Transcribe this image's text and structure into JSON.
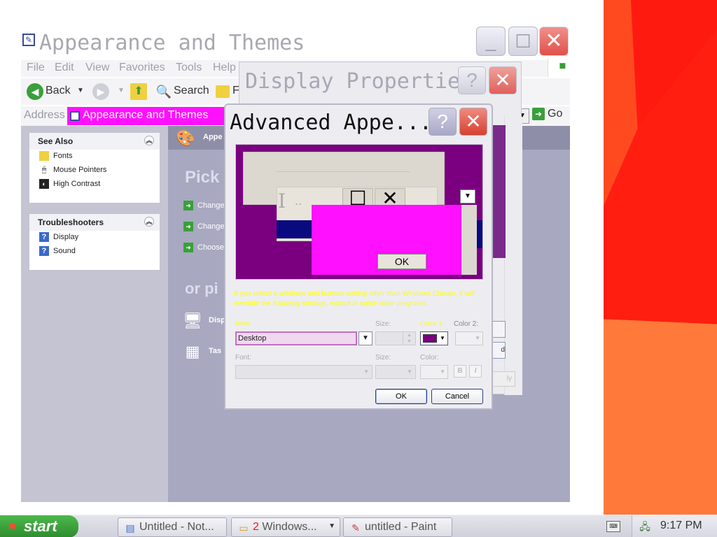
{
  "explorer": {
    "title": "Appearance and Themes",
    "menu": [
      "File",
      "Edit",
      "View",
      "Favorites",
      "Tools",
      "Help"
    ],
    "toolbar": {
      "back": "Back",
      "search": "Search",
      "folders": "F"
    },
    "address": {
      "label": "Address",
      "value": "Appearance and Themes",
      "go": "Go"
    },
    "see_also": {
      "title": "See Also",
      "items": [
        "Fonts",
        "Mouse Pointers",
        "High Contrast"
      ]
    },
    "troubleshooters": {
      "title": "Troubleshooters",
      "items": [
        "Display",
        "Sound"
      ]
    },
    "main": {
      "header": "Appe",
      "pick": "Pick",
      "links": [
        "Change",
        "Change",
        "Choose"
      ],
      "or_pick": "or pi",
      "icons": [
        "Disp",
        "Tas"
      ]
    }
  },
  "display_props": {
    "title": "Display Properties",
    "side_label": "d",
    "apply": "ly"
  },
  "advanced": {
    "title": "Advanced Appe...",
    "preview": {
      "ibeam": "I",
      "dots": "..",
      "ok": "OK"
    },
    "note": "If you select a windows and buttons setting other than Windows Classic, it will override the following settings, except in some older programs.",
    "item_label": "Item:",
    "item_value": "Desktop",
    "size_label": "Size:",
    "color1_label": "Color 1:",
    "color2_label": "Color 2:",
    "font_label": "Font:",
    "fsize_label": "Size:",
    "fcolor_label": "Color:",
    "bold": "B",
    "italic": "I",
    "ok": "OK",
    "cancel": "Cancel"
  },
  "taskbar": {
    "start": "start",
    "buttons": [
      {
        "label": "Untitled - Not..."
      },
      {
        "count": "2",
        "label": "Windows..."
      },
      {
        "label": "untitled - Paint"
      }
    ],
    "clock": "9:17 PM"
  },
  "colors": {
    "desktop_color": "#7a0080",
    "address_highlight": "#ff10ff",
    "note_text": "#ffff00"
  }
}
